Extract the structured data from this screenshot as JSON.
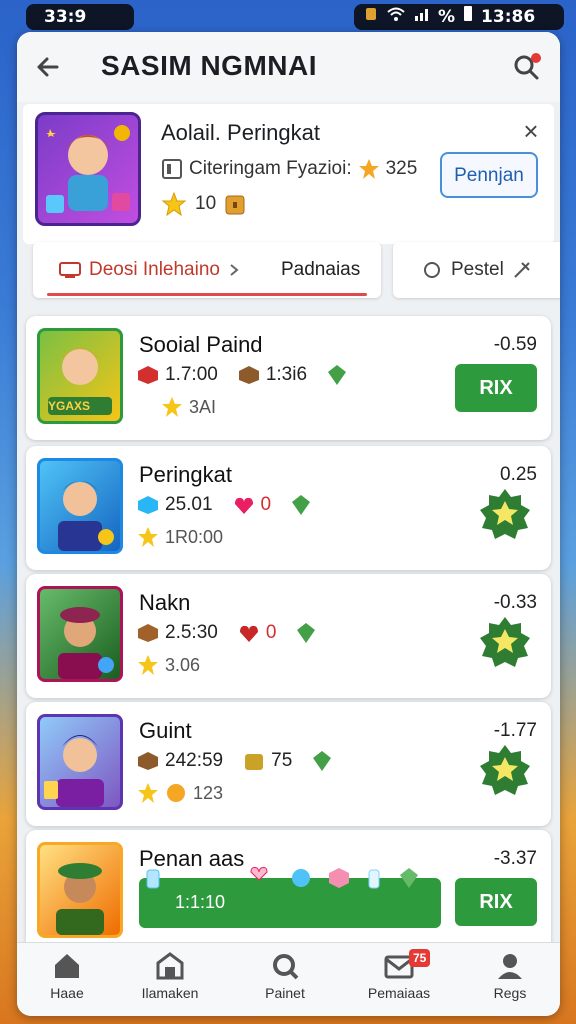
{
  "status_bar": {
    "time_left": "33:9",
    "signal": "%",
    "time_right": "13:86"
  },
  "header": {
    "title": "SASIM NGMNAI"
  },
  "featured": {
    "title": "Aolail. Peringkat",
    "meta": "Citeringam Fyazioi:",
    "rating": "325",
    "count": "10",
    "button": "Pennjan"
  },
  "tabs": {
    "tab1_a": "Deosi Inlehaino",
    "tab1_b": "Padnaias",
    "tab2": "Pestel"
  },
  "cards": [
    {
      "name": "Sooial Paind",
      "score": "-0.59",
      "v1": "1.7:00",
      "v2": "1:3i6",
      "sub": "3AI",
      "action": "RIX",
      "thumb_label": "YGAXS"
    },
    {
      "name": "Peringkat",
      "score": "0.25",
      "v1": "25.01",
      "v2": "0",
      "sub": "1R0:00"
    },
    {
      "name": "Nakn",
      "score": "-0.33",
      "v1": "2.5:30",
      "v2": "0",
      "sub": "3.06"
    },
    {
      "name": "Guint",
      "score": "-1.77",
      "v1": "242:59",
      "v2": "75",
      "sub": "123"
    },
    {
      "name": "Penan aas",
      "score": "-3.37",
      "progress": "1:1:10",
      "action": "RIX"
    }
  ],
  "nav": [
    {
      "label": "Haae",
      "icon": "home-icon"
    },
    {
      "label": "Ilamaken",
      "icon": "store-icon"
    },
    {
      "label": "Painet",
      "icon": "search-icon"
    },
    {
      "label": "Pemaiaas",
      "icon": "mail-icon",
      "badge": "75"
    },
    {
      "label": "Regs",
      "icon": "profile-icon"
    }
  ],
  "colors": {
    "accent_green": "#2e9a3e",
    "accent_red": "#e04a4a",
    "link_blue": "#4a90d9"
  }
}
